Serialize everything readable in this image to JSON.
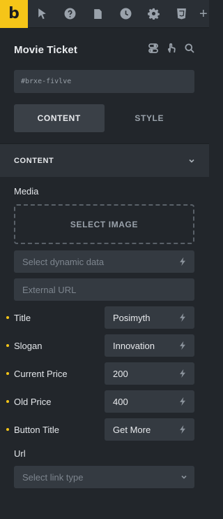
{
  "toolbar": {
    "logo": "b",
    "icons": [
      "cursor-icon",
      "help-icon",
      "page-icon",
      "history-icon",
      "settings-icon",
      "css3-icon",
      "add-icon"
    ],
    "last_glyph": "+"
  },
  "header": {
    "title": "Movie Ticket"
  },
  "element_id": "#brxe-fivlve",
  "tabs": [
    {
      "label": "CONTENT"
    },
    {
      "label": "STYLE"
    }
  ],
  "section": {
    "label": "CONTENT"
  },
  "media": {
    "label": "Media",
    "select_image": "SELECT IMAGE",
    "dynamic_placeholder": "Select dynamic data",
    "external_url_placeholder": "External URL"
  },
  "fields": [
    {
      "label": "Title",
      "value": "Posimyth"
    },
    {
      "label": "Slogan",
      "value": "Innovation"
    },
    {
      "label": "Current Price",
      "value": "200"
    },
    {
      "label": "Old Price",
      "value": "400"
    },
    {
      "label": "Button Title",
      "value": "Get More"
    }
  ],
  "url": {
    "label": "Url",
    "placeholder": "Select link type"
  },
  "colors": {
    "accent": "#f5c518",
    "panel": "#22262b",
    "input": "#343a41"
  }
}
